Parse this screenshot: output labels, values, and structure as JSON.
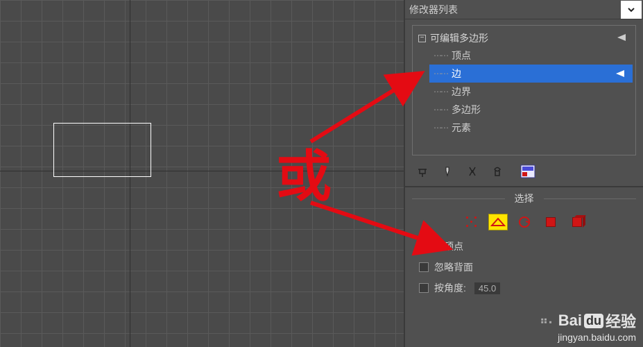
{
  "modifier_list_label": "修改器列表",
  "tree": {
    "root_label": "可编辑多边形",
    "items": [
      {
        "label": "顶点"
      },
      {
        "label": "边",
        "selected": true
      },
      {
        "label": "边界"
      },
      {
        "label": "多边形"
      },
      {
        "label": "元素"
      }
    ]
  },
  "annotation_text": "或",
  "section_selection": "选择",
  "chk_by_vertex": "按顶点",
  "chk_ignore_backfacing": "忽略背面",
  "chk_by_angle": "按角度:",
  "angle_value": "45.0",
  "watermark": {
    "brand": "Bai",
    "du": "du",
    "product": "经验",
    "url": "jingyan.baidu.com"
  }
}
